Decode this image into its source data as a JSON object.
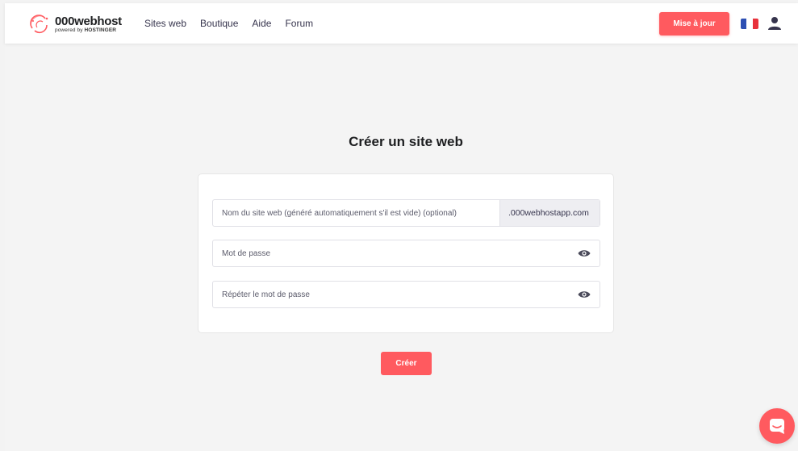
{
  "header": {
    "logo": {
      "name": "000webhost",
      "powered_prefix": "powered by",
      "powered_brand": "HOSTINGER"
    },
    "nav": [
      "Sites web",
      "Boutique",
      "Aide",
      "Forum"
    ],
    "upgrade_label": "Mise à jour",
    "language": "fr",
    "icons": {
      "flag": "france-flag-icon",
      "user": "user-icon"
    }
  },
  "main": {
    "title": "Créer un site web",
    "form": {
      "site_name_placeholder": "Nom du site web (généré automatiquement s'il est vide) (optional)",
      "site_name_value": "",
      "domain_suffix": ".000webhostapp.com",
      "password_placeholder": "Mot de passe",
      "password_value": "",
      "repeat_password_placeholder": "Répéter le mot de passe",
      "repeat_password_value": ""
    },
    "submit_label": "Créer"
  },
  "colors": {
    "accent": "#ff5a5f",
    "background": "#f4f4f4",
    "text": "#1d1e20"
  }
}
